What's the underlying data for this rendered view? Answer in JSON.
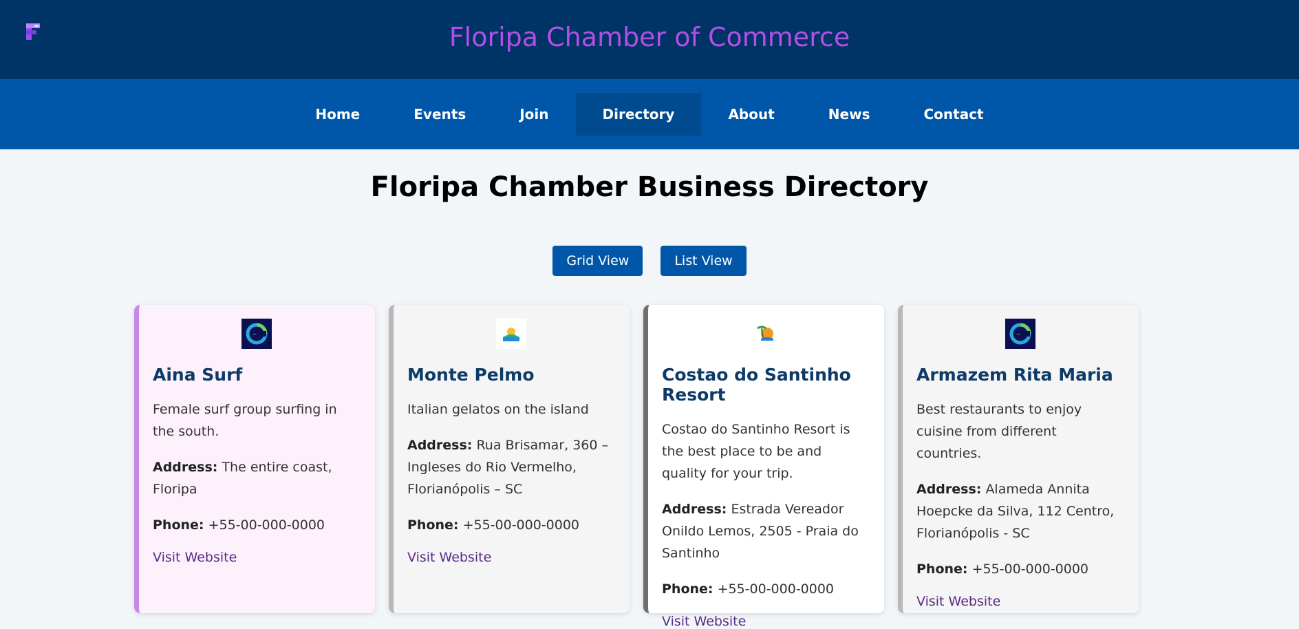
{
  "header": {
    "title": "Floripa Chamber of Commerce",
    "logo_icon": "floripa-f-logo-icon",
    "title_color": "#b44ee6",
    "background": "#003366"
  },
  "nav": {
    "items": [
      {
        "label": "Home"
      },
      {
        "label": "Events"
      },
      {
        "label": "Join"
      },
      {
        "label": "Directory",
        "active": true
      },
      {
        "label": "About"
      },
      {
        "label": "News"
      },
      {
        "label": "Contact"
      }
    ]
  },
  "main": {
    "heading": "Floripa Chamber Business Directory",
    "grid_view_label": "Grid View",
    "list_view_label": "List View",
    "address_label": "Address:",
    "phone_label": "Phone:",
    "businesses": [
      {
        "name": "Aina Surf",
        "description": "Female surf group surfing in the south.",
        "address": "The entire coast, Floripa",
        "phone": "+55-00-000-0000",
        "link": "Visit Website",
        "logo_icon": "wave-logo-icon"
      },
      {
        "name": "Monte Pelmo",
        "description": "Italian gelatos on the island",
        "address": "Rua Brisamar, 360 – Ingleses do Rio Vermelho, Florianópolis – SC",
        "phone": "+55-00-000-0000",
        "link": "Visit Website",
        "logo_icon": "island-logo-icon"
      },
      {
        "name": "Costao do Santinho Resort",
        "description": "Costao do Santinho Resort is the best place to be and quality for your trip.",
        "address": "Estrada Vereador Onildo Lemos, 2505 - Praia do Santinho",
        "phone": "+55-00-000-0000",
        "link": "Visit Website",
        "logo_icon": "palm-sun-logo-icon"
      },
      {
        "name": "Armazem Rita Maria",
        "description": "Best restaurants to enjoy cuisine from different countries.",
        "address": "Alameda Annita Hoepcke da Silva, 112 Centro, Florianópolis - SC",
        "phone": "+55-00-000-0000",
        "link": "Visit Website",
        "logo_icon": "wave-logo-icon"
      }
    ]
  },
  "colors": {
    "nav_bg": "#0056a8",
    "nav_active_bg": "#004a8f",
    "card_name": "#0d3a66",
    "link": "#5a2a8a",
    "featured_border": "#c58ae8"
  }
}
